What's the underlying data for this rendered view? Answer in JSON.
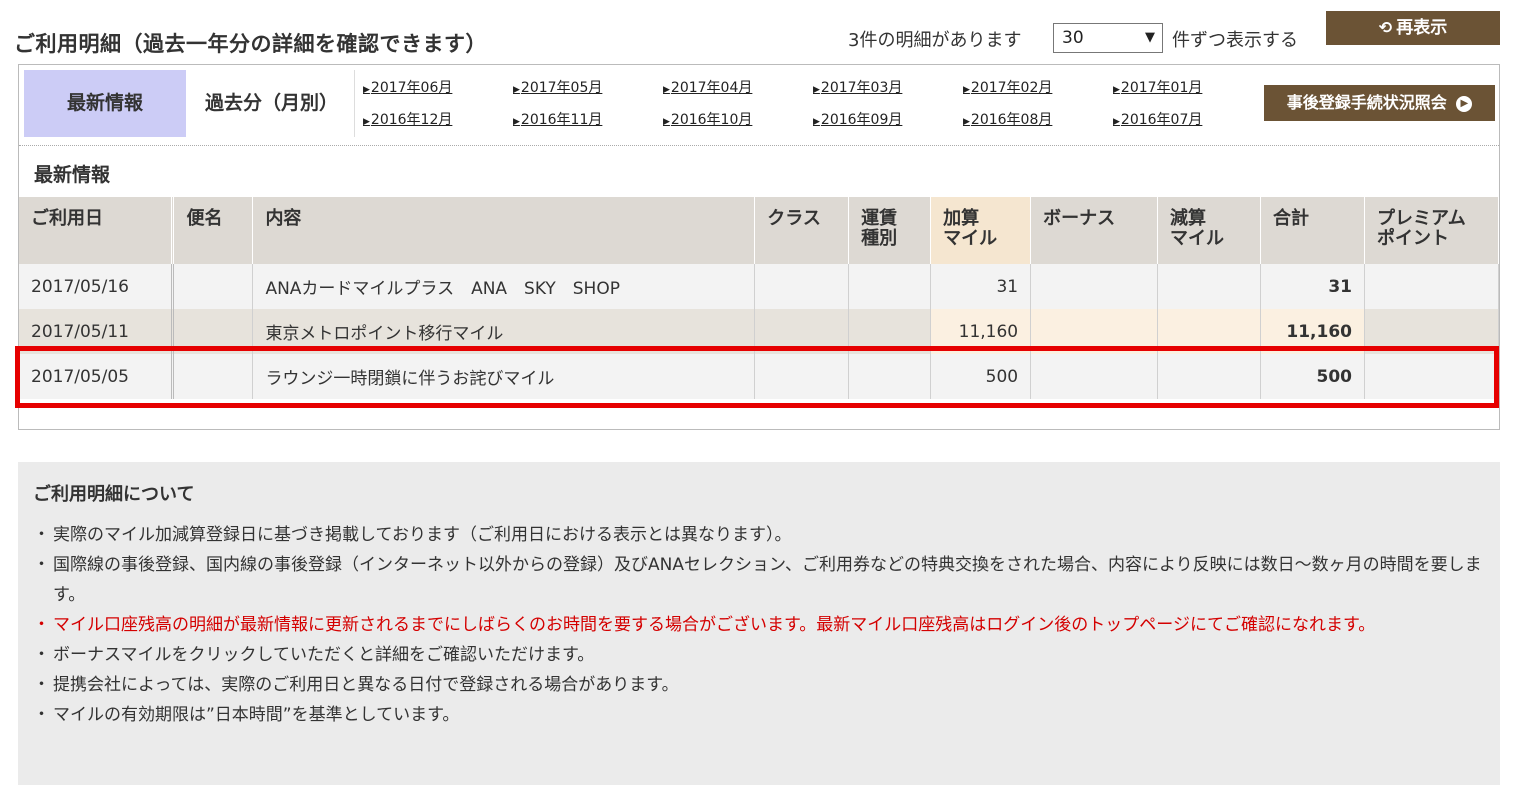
{
  "page_title": "ご利用明細（過去一年分の詳細を確認できます）",
  "count_text": "3件の明細があります",
  "per_page": {
    "value": "30",
    "suffix": "件ずつ表示する"
  },
  "redisplay_label": "再表示",
  "tabs": {
    "latest": "最新情報",
    "past": "過去分（月別）"
  },
  "month_links_row1": [
    "2017年06月",
    "2017年05月",
    "2017年04月",
    "2017年03月",
    "2017年02月",
    "2017年01月"
  ],
  "month_links_row2": [
    "2016年12月",
    "2016年11月",
    "2016年10月",
    "2016年09月",
    "2016年08月",
    "2016年07月"
  ],
  "post_reg_label": "事後登録手続状況照会",
  "section_heading": "最新情報",
  "table": {
    "headers": {
      "date": "ご利用日",
      "flight": "便名",
      "content": "内容",
      "class": "クラス",
      "fare_line1": "運賃",
      "fare_line2": "種別",
      "add_line1": "加算",
      "add_line2": "マイル",
      "bonus": "ボーナス",
      "sub_line1": "減算",
      "sub_line2": "マイル",
      "total": "合計",
      "premium_line1": "プレミアム",
      "premium_line2": "ポイント"
    },
    "rows": [
      {
        "date": "2017/05/16",
        "flight": "",
        "content": "ANAカードマイルプラス　ANA　SKY　SHOP",
        "class": "",
        "fare": "",
        "added": "31",
        "bonus": "",
        "subtracted": "",
        "total": "31",
        "premium": ""
      },
      {
        "date": "2017/05/11",
        "flight": "",
        "content": "東京メトロポイント移行マイル",
        "class": "",
        "fare": "",
        "added": "11,160",
        "bonus": "",
        "subtracted": "",
        "total": "11,160",
        "premium": ""
      },
      {
        "date": "2017/05/05",
        "flight": "",
        "content": "ラウンジ一時閉鎖に伴うお詫びマイル",
        "class": "",
        "fare": "",
        "added": "500",
        "bonus": "",
        "subtracted": "",
        "total": "500",
        "premium": ""
      }
    ]
  },
  "notes": {
    "heading": "ご利用明細について",
    "items": [
      "実際のマイル加減算登録日に基づき掲載しております（ご利用日における表示とは異なります）。",
      "国際線の事後登録、国内線の事後登録（インターネット以外からの登録）及びANAセレクション、ご利用券などの特典交換をされた場合、内容により反映には数日～数ヶ月の時間を要します。",
      "マイル口座残高の明細が最新情報に更新されるまでにしばらくのお時間を要する場合がございます。最新マイル口座残高はログイン後のトップページにてご確認になれます。",
      "ボーナスマイルをクリックしていただくと詳細をご確認いただけます。",
      "提携会社によっては、実際のご利用日と異なる日付で登録される場合があります。",
      "マイルの有効期限は”日本時間”を基準としています。"
    ]
  },
  "colors": {
    "accent_brown": "#6b5335",
    "tab_active": "#ccccf6",
    "highlight_red": "#e60000",
    "notice_red": "#d40000"
  },
  "icons": {
    "redisplay": "refresh-icon",
    "post_reg": "arrow-circle-right-icon",
    "month_link": "triangle-right-icon",
    "select": "chevron-down-icon"
  }
}
